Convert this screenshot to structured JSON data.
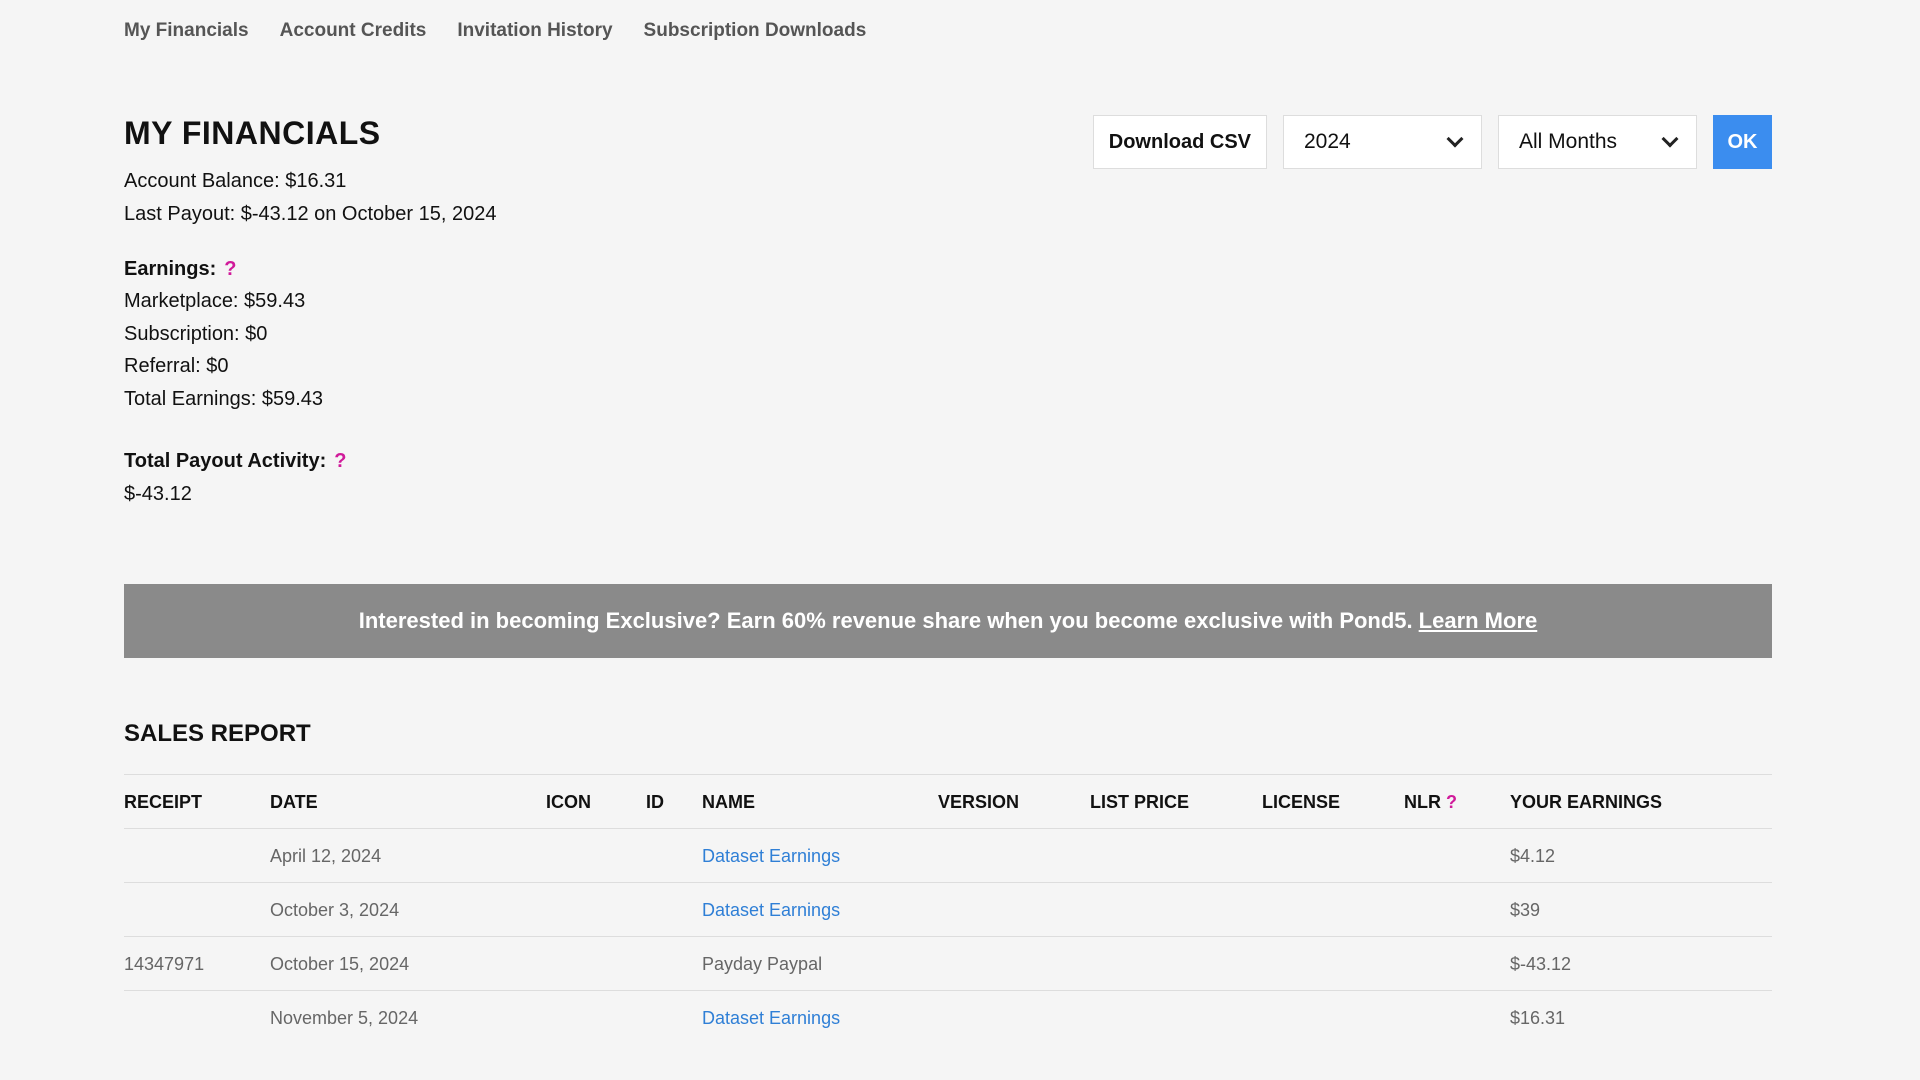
{
  "nav": [
    "My Financials",
    "Account Credits",
    "Invitation History",
    "Subscription Downloads"
  ],
  "page_title": "MY FINANCIALS",
  "account_balance": "Account Balance: $16.31",
  "last_payout": "Last Payout: $-43.12 on October 15, 2024",
  "earnings": {
    "label": "Earnings:",
    "help": "?",
    "marketplace": "Marketplace: $59.43",
    "subscription": "Subscription: $0",
    "referral": "Referral: $0",
    "total": "Total Earnings: $59.43"
  },
  "payout_activity": {
    "label": "Total Payout Activity:",
    "help": "?",
    "value": "$-43.12"
  },
  "controls": {
    "download_csv": "Download CSV",
    "year": "2024",
    "month": "All Months",
    "ok": "OK"
  },
  "banner": {
    "text": "Interested in becoming Exclusive? Earn 60% revenue share when you become exclusive with Pond5.",
    "link": "Learn More"
  },
  "sales_report": {
    "title": "SALES REPORT",
    "columns": {
      "receipt": "RECEIPT",
      "date": "DATE",
      "icon": "ICON",
      "id": "ID",
      "name": "NAME",
      "version": "VERSION",
      "list_price": "LIST PRICE",
      "license": "LICENSE",
      "nlr": "NLR",
      "nlr_help": "?",
      "earnings": "YOUR EARNINGS"
    },
    "rows": [
      {
        "receipt": "",
        "date": "April 12, 2024",
        "name": "Dataset Earnings",
        "earnings": "$4.12"
      },
      {
        "receipt": "",
        "date": "October 3, 2024",
        "name": "Dataset Earnings",
        "earnings": "$39"
      },
      {
        "receipt": "14347971",
        "date": "October 15, 2024",
        "name": "Payday Paypal",
        "earnings": "$-43.12"
      },
      {
        "receipt": "",
        "date": "November 5, 2024",
        "name": "Dataset Earnings",
        "earnings": "$16.31"
      }
    ]
  }
}
